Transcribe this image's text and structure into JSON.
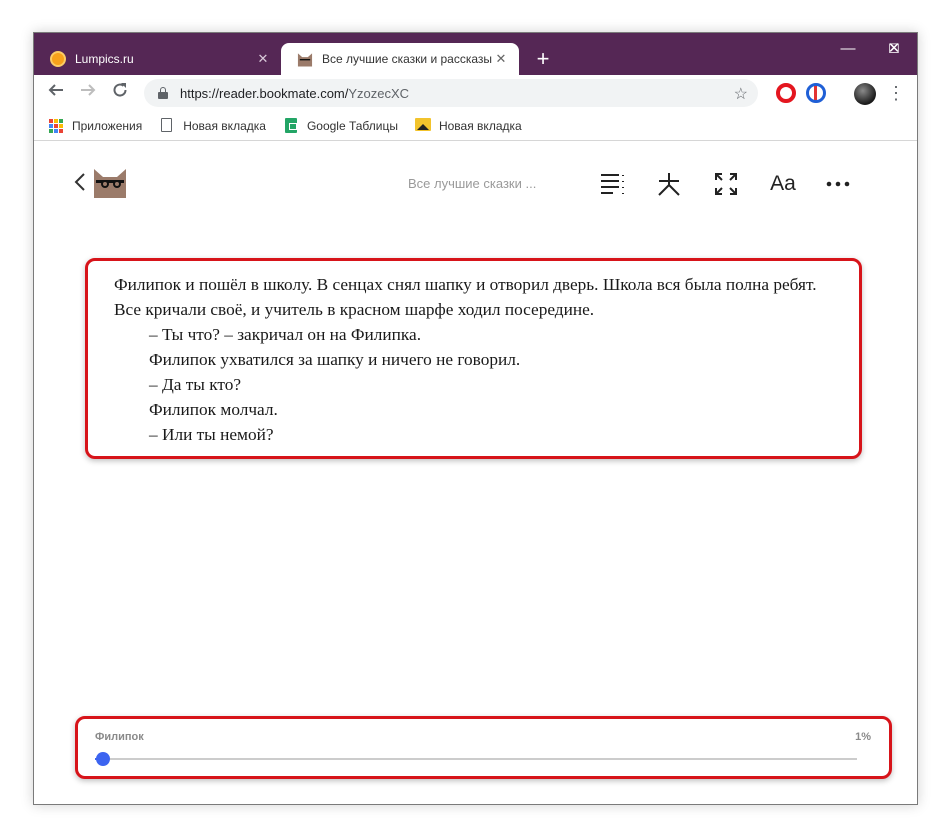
{
  "browser": {
    "tabs": [
      {
        "title": "Lumpics.ru",
        "close": "✕"
      },
      {
        "title": "Все лучшие сказки и рассказы, ",
        "close": "✕"
      }
    ],
    "new_tab": "+",
    "window_controls": {
      "minimize": "—",
      "maximize": "☐",
      "close": "✕"
    },
    "url": {
      "host": "https://reader.bookmate.com/",
      "path": "YzozecXC"
    },
    "bookmarks": [
      {
        "label": "Приложения",
        "icon": "apps-grid-icon"
      },
      {
        "label": "Новая вкладка",
        "icon": "page-icon"
      },
      {
        "label": "Google Таблицы",
        "icon": "sheets-icon"
      },
      {
        "label": "Новая вкладка",
        "icon": "image-icon"
      }
    ]
  },
  "reader": {
    "book_title": "Все лучшие сказки ...",
    "toolbar_font_label": "Aa",
    "text": {
      "paragraph": "Филипок и пошёл в школу. В сенцах снял шапку и отворил дверь. Школа вся была полна ребят. Все кричали своё, и учитель в красном шарфе ходил посередине.",
      "lines": [
        "– Ты что? – закричал он на Филипка.",
        "Филипок ухватился за шапку и ничего не говорил.",
        "– Да ты кто?",
        "Филипок молчал.",
        "– Или ты немой?"
      ]
    },
    "progress": {
      "chapter": "Филипок",
      "percent_label": "1%",
      "value": 0.01
    }
  },
  "colors": {
    "titlebar": "#552755",
    "highlight": "#d7141a",
    "accent": "#3c64f0"
  }
}
